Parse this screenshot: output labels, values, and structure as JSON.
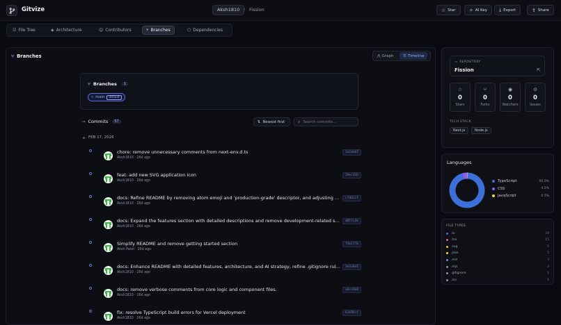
{
  "app": {
    "title": "Gitvize"
  },
  "breadcrumb": {
    "owner": "Aksh1810",
    "separator": "/",
    "repo": "Fission"
  },
  "toolbar": {
    "star": "Star",
    "ai_key": "AI Key",
    "export": "Export",
    "share": "Share"
  },
  "tabs": [
    "File Tree",
    "Architecture",
    "Contributors",
    "Branches",
    "Dependencies"
  ],
  "active_tab": "Branches",
  "main": {
    "title": "Branches",
    "view_toggle": {
      "graph": "Graph",
      "timeline": "Timeline",
      "active": "Timeline"
    },
    "branches_card": {
      "title": "Branches",
      "count": "1",
      "branch": "main",
      "badge": "default"
    },
    "commits": {
      "title": "Commits",
      "count": "57",
      "sort": "Newest first",
      "search_placeholder": "Search commits...",
      "date_group": "FEB 17, 2026",
      "items": [
        {
          "message": "chore: remove unnecessary comments from next-env.d.ts",
          "author": "Aksh1810",
          "time": "26d ago",
          "hash": "3a5da07"
        },
        {
          "message": "feat: add new SVG application icon",
          "author": "Aksh1810",
          "time": "26d ago",
          "hash": "39ec335"
        },
        {
          "message": "docs: Refine README by removing atom emoji and 'production-grade' descriptor, and adjusting dir...",
          "author": "Aksh1810",
          "time": "26d ago",
          "hash": "c7d61cf"
        },
        {
          "message": "docs: Expand the features section with detailed descriptions and remove development-related se...",
          "author": "Aksh1810",
          "time": "26d ago",
          "hash": "d8f7c2b"
        },
        {
          "message": "Simplify README and remove getting started section",
          "author": "Aksh Patel",
          "time": "26d ago",
          "hash": "f3b1f7b"
        },
        {
          "message": "docs: Enhance README with detailed features, architecture, and AI strategy, refine .gitignore rules,...",
          "author": "Aksh1810",
          "time": "26d ago",
          "hash": "3e5a0d1"
        },
        {
          "message": "docs: remove verbose comments from core logic and component files.",
          "author": "Aksh1810",
          "time": "26d ago",
          "hash": "a6cd3b8"
        },
        {
          "message": "fix: resolve TypeScript build errors for Vercel deployment",
          "author": "Aksh1810",
          "time": "26d ago",
          "hash": "61b9bcf"
        }
      ]
    }
  },
  "repository": {
    "label": "REPOSITORY",
    "name": "Fission",
    "stats": [
      {
        "label": "Stars",
        "value": "0",
        "icon": "star-icon"
      },
      {
        "label": "Forks",
        "value": "0",
        "icon": "fork-icon"
      },
      {
        "label": "Watchers",
        "value": "0",
        "icon": "eye-icon"
      },
      {
        "label": "Issues",
        "value": "0",
        "icon": "issue-icon"
      }
    ],
    "tech_stack_label": "TECH STACK",
    "tech_stack": [
      "Next.js",
      "Node.js"
    ]
  },
  "languages": {
    "title": "Languages",
    "items": [
      {
        "name": "TypeScript",
        "pct": "95.0%",
        "value": 95.0,
        "color": "#3d6fd9"
      },
      {
        "name": "CSS",
        "pct": "4.5%",
        "value": 4.5,
        "color": "#8b5cf6"
      },
      {
        "name": "JavaScript",
        "pct": "0.5%",
        "value": 0.5,
        "color": "#f5d94a"
      }
    ]
  },
  "file_types": {
    "title": "FILE TYPES",
    "items": [
      {
        "ext": ".ts",
        "count": "19",
        "color": "#3d6fd9"
      },
      {
        "ext": ".tsx",
        "count": "15",
        "color": "#e25aa8"
      },
      {
        "ext": ".svg",
        "count": "5",
        "color": "#f5c542"
      },
      {
        "ext": ".json",
        "count": "5",
        "color": "#f5d94a"
      },
      {
        "ext": ".md",
        "count": "3",
        "color": "#5e8ee8"
      },
      {
        "ext": ".mjs",
        "count": "2",
        "color": "#8e92a0"
      },
      {
        "ext": ".gitignore",
        "count": "1",
        "color": "#8e92a0"
      },
      {
        "ext": ".ico",
        "count": "1",
        "color": "#8e92a0"
      }
    ]
  }
}
